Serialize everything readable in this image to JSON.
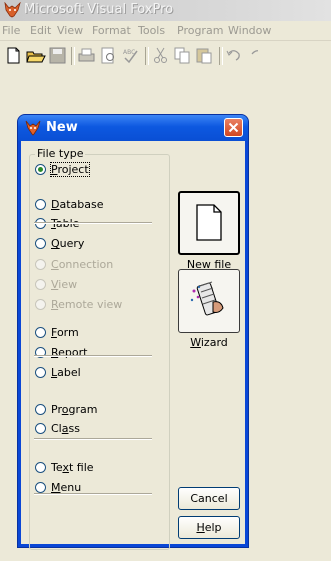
{
  "app": {
    "title": "Microsoft Visual FoxPro",
    "menu": [
      "File",
      "Edit",
      "View",
      "Format",
      "Tools",
      "Program",
      "Window"
    ]
  },
  "toolbar": {
    "buttons": [
      "new-file-icon",
      "open-folder-icon",
      "save-icon",
      "print-icon",
      "print-preview-icon",
      "spell-check-icon",
      "cut-icon",
      "copy-icon",
      "paste-icon",
      "undo-icon",
      "redo-icon"
    ]
  },
  "dialog": {
    "title": "New",
    "group_label": "File type",
    "options": [
      {
        "label": "Project",
        "accel": "P",
        "checked": true,
        "enabled": true
      },
      {
        "label": "Database",
        "accel": "D",
        "checked": false,
        "enabled": true
      },
      {
        "label": "Table",
        "accel": "T",
        "checked": false,
        "enabled": true
      },
      {
        "label": "Query",
        "accel": "Q",
        "checked": false,
        "enabled": true
      },
      {
        "label": "Connection",
        "accel": "C",
        "checked": false,
        "enabled": false
      },
      {
        "label": "View",
        "accel": "V",
        "checked": false,
        "enabled": false
      },
      {
        "label": "Remote view",
        "accel": "R",
        "checked": false,
        "enabled": false
      },
      {
        "label": "Form",
        "accel": "F",
        "checked": false,
        "enabled": true
      },
      {
        "label": "Report",
        "accel": "R",
        "checked": false,
        "enabled": true
      },
      {
        "label": "Label",
        "accel": "L",
        "checked": false,
        "enabled": true
      },
      {
        "label": "Program",
        "accel": "o",
        "checked": false,
        "enabled": true
      },
      {
        "label": "Class",
        "accel": "a",
        "checked": false,
        "enabled": true
      },
      {
        "label": "Text file",
        "accel": "x",
        "checked": false,
        "enabled": true
      },
      {
        "label": "Menu",
        "accel": "M",
        "checked": false,
        "enabled": true
      }
    ],
    "new_file_label": "New file",
    "wizard_label": "Wizard",
    "cancel_label": "Cancel",
    "help_label": "Help"
  },
  "colors": {
    "dialog_title_blue": "#0a4fd4",
    "close_red": "#d24721",
    "dialog_face": "#ece9d8"
  }
}
